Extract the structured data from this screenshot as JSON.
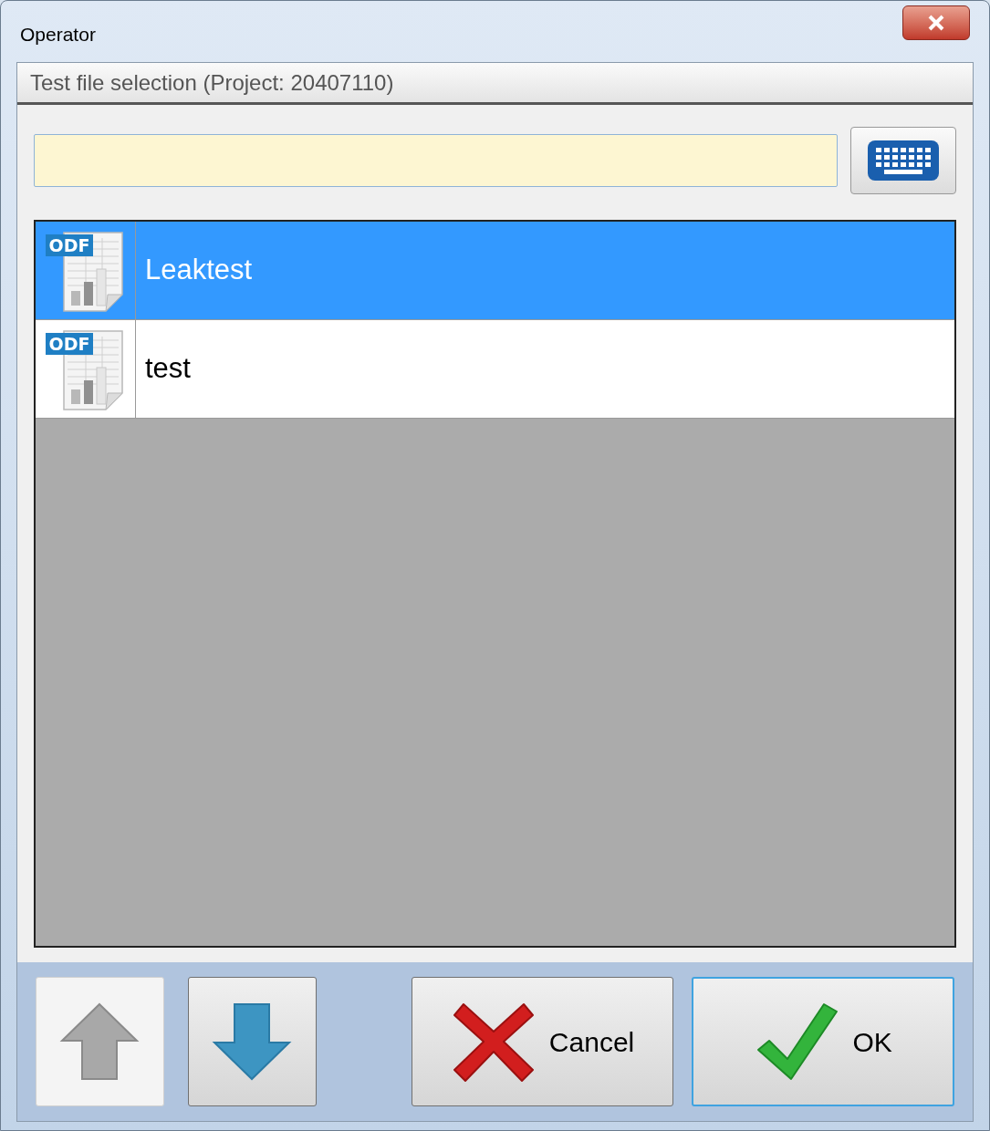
{
  "window": {
    "title": "Operator"
  },
  "header": {
    "title": "Test file selection (Project: 20407110)"
  },
  "files": [
    {
      "badge": "ODF",
      "name": "Leaktest",
      "selected": true
    },
    {
      "badge": "ODF",
      "name": "test",
      "selected": false
    }
  ],
  "buttons": [
    {
      "kind": "up",
      "disabled": true
    },
    {
      "kind": "down",
      "disabled": false
    },
    {
      "kind": "cancel",
      "label": "Cancel",
      "default": false
    },
    {
      "kind": "ok",
      "label": "OK",
      "default": true
    }
  ]
}
